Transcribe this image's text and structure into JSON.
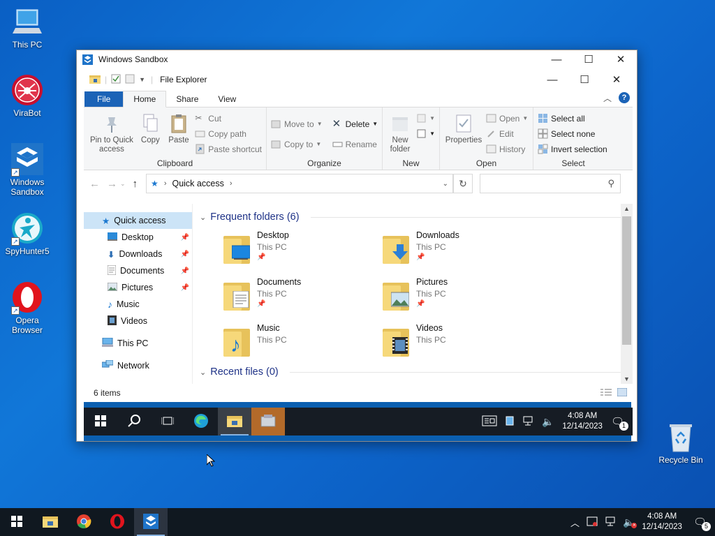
{
  "desktop": {
    "icons": [
      {
        "label": "This PC",
        "icon": "computer-icon"
      },
      {
        "label": "ViraBot",
        "icon": "virabot-icon"
      },
      {
        "label": "Windows Sandbox",
        "icon": "sandbox-icon"
      },
      {
        "label": "SpyHunter5",
        "icon": "spyhunter-icon"
      },
      {
        "label": "Opera Browser",
        "icon": "opera-icon"
      },
      {
        "label": "Recycle Bin",
        "icon": "recycle-bin-icon"
      }
    ]
  },
  "sandbox_window": {
    "title": "Windows Sandbox"
  },
  "explorer": {
    "title": "File Explorer",
    "tabs": {
      "file": "File",
      "home": "Home",
      "share": "Share",
      "view": "View"
    },
    "ribbon": {
      "clipboard": {
        "label": "Clipboard",
        "pin": "Pin to Quick access",
        "copy": "Copy",
        "paste": "Paste",
        "cut": "Cut",
        "copy_path": "Copy path",
        "paste_shortcut": "Paste shortcut"
      },
      "organize": {
        "label": "Organize",
        "move_to": "Move to",
        "copy_to": "Copy to",
        "delete": "Delete",
        "rename": "Rename"
      },
      "new": {
        "label": "New",
        "new_folder": "New folder"
      },
      "open": {
        "label": "Open",
        "properties": "Properties",
        "open": "Open",
        "edit": "Edit",
        "history": "History"
      },
      "select": {
        "label": "Select",
        "select_all": "Select all",
        "select_none": "Select none",
        "invert": "Invert selection"
      }
    },
    "address": {
      "path": "Quick access",
      "search_placeholder": ""
    },
    "nav_pane": {
      "quick_access": "Quick access",
      "desktop": "Desktop",
      "downloads": "Downloads",
      "documents": "Documents",
      "pictures": "Pictures",
      "music": "Music",
      "videos": "Videos",
      "this_pc": "This PC",
      "network": "Network"
    },
    "frequent_header": "Frequent folders (6)",
    "recent_header": "Recent files (0)",
    "folders": [
      {
        "name": "Desktop",
        "location": "This PC"
      },
      {
        "name": "Downloads",
        "location": "This PC"
      },
      {
        "name": "Documents",
        "location": "This PC"
      },
      {
        "name": "Pictures",
        "location": "This PC"
      },
      {
        "name": "Music",
        "location": "This PC"
      },
      {
        "name": "Videos",
        "location": "This PC"
      }
    ],
    "status": "6 items"
  },
  "sandbox_taskbar": {
    "time": "4:08 AM",
    "date": "12/14/2023",
    "notifications": "1"
  },
  "taskbar": {
    "time": "4:08 AM",
    "date": "12/14/2023",
    "notifications": "5"
  },
  "colors": {
    "accent": "#1b63b7",
    "folder": "#f6d87a",
    "selection": "#cce4f7"
  }
}
